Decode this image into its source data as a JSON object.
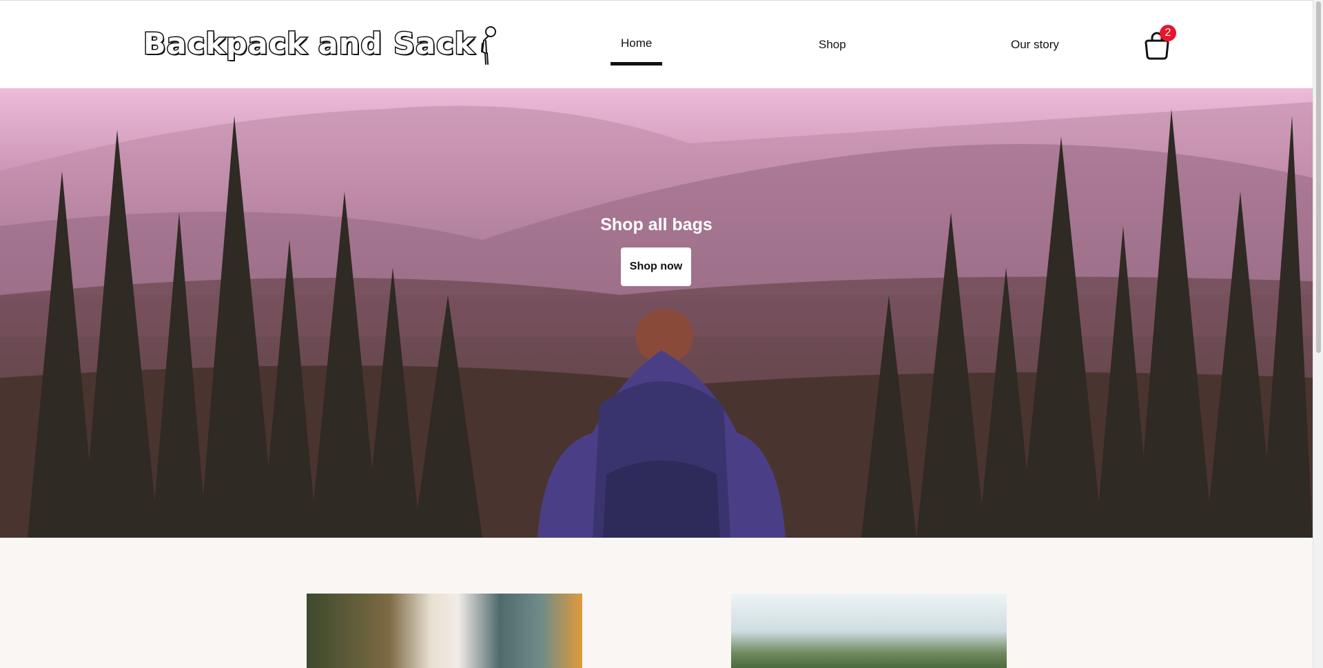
{
  "header": {
    "logo_text": "Backpack and Sack",
    "nav": [
      {
        "label": "Home",
        "active": true
      },
      {
        "label": "Shop",
        "active": false
      },
      {
        "label": "Our story",
        "active": false
      }
    ],
    "cart_count": "2"
  },
  "hero": {
    "title": "Shop all bags",
    "button_label": "Shop now"
  },
  "colors": {
    "badge": "#e8152d",
    "header_bg": "#ffffff",
    "page_bg": "#faf6f4"
  },
  "icons": [
    "stick-figure-logo-icon",
    "shopping-bag-icon"
  ]
}
